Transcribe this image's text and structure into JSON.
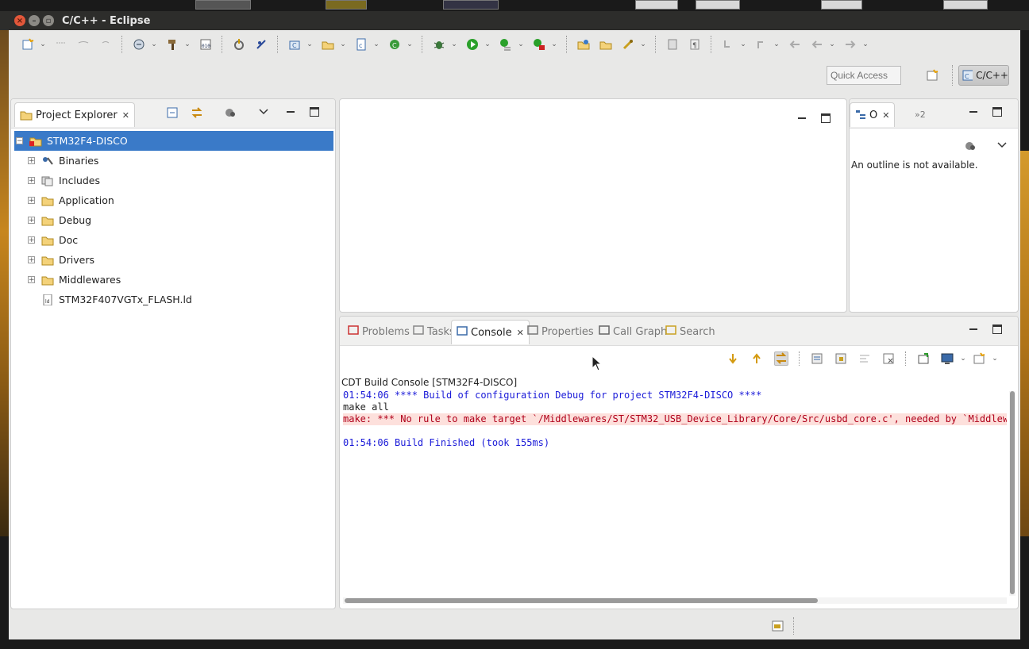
{
  "window": {
    "title": "C/C++ - Eclipse"
  },
  "toolbar": {
    "quick_access_placeholder": "Quick Access",
    "perspective_label": "C/C++"
  },
  "project_explorer": {
    "tab_label": "Project Explorer",
    "root": "STM32F4-DISCO",
    "items": [
      {
        "label": "Binaries",
        "icon": "binaries-icon"
      },
      {
        "label": "Includes",
        "icon": "includes-icon"
      },
      {
        "label": "Application",
        "icon": "folder-icon"
      },
      {
        "label": "Debug",
        "icon": "folder-icon"
      },
      {
        "label": "Doc",
        "icon": "folder-icon"
      },
      {
        "label": "Drivers",
        "icon": "folder-icon"
      },
      {
        "label": "Middlewares",
        "icon": "folder-icon"
      },
      {
        "label": "STM32F407VGTx_FLASH.ld",
        "icon": "ld-file-icon"
      }
    ]
  },
  "outline": {
    "tab_label": "O",
    "overflow_label": "»2",
    "message": "An outline is not available."
  },
  "bottom_panel": {
    "tabs": [
      {
        "label": "Problems",
        "icon": "problems-icon"
      },
      {
        "label": "Tasks",
        "icon": "tasks-icon"
      },
      {
        "label": "Console",
        "icon": "console-icon"
      },
      {
        "label": "Properties",
        "icon": "properties-icon"
      },
      {
        "label": "Call Graph",
        "icon": "call-graph-icon"
      },
      {
        "label": "Search",
        "icon": "search-icon"
      }
    ],
    "active_tab": "Console"
  },
  "console": {
    "title": "CDT Build Console [STM32F4-DISCO]",
    "lines": [
      "01:54:06 **** Build of configuration Debug for project STM32F4-DISCO ****",
      "make all",
      "make: *** No rule to make target `/Middlewares/ST/STM32_USB_Device_Library/Core/Src/usbd_core.c', needed by `Middleware",
      "",
      "01:54:06 Build Finished (took 155ms)"
    ]
  },
  "colors": {
    "selection": "#3a7ac8",
    "console_blue": "#1a1ad8",
    "console_error_bg": "#fde0dc",
    "titlebar": "#2d2d2b"
  }
}
